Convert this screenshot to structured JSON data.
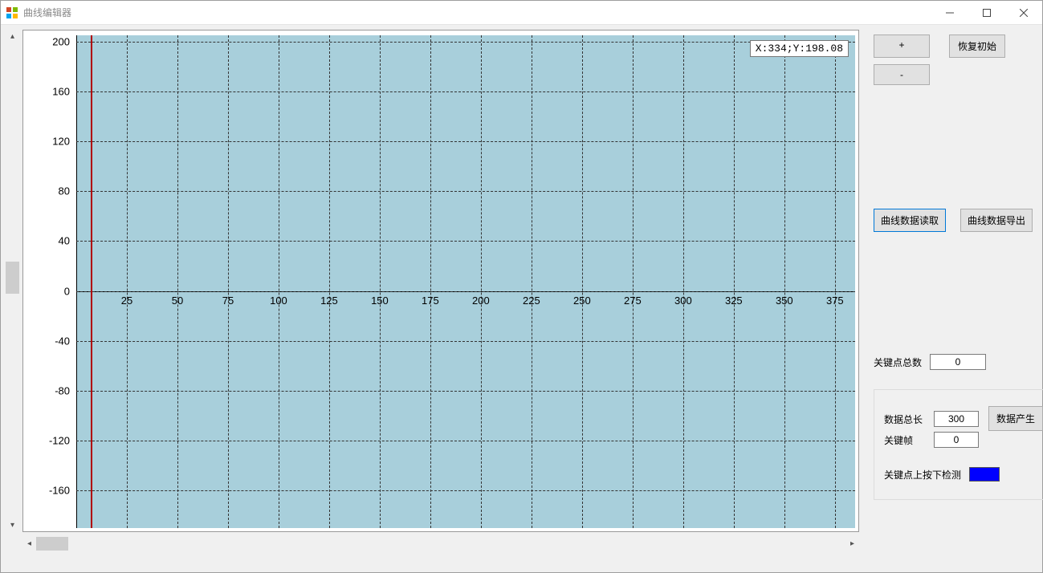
{
  "window": {
    "title": "曲线编辑器"
  },
  "chart_data": {
    "type": "line",
    "x_ticks": [
      25,
      50,
      75,
      100,
      125,
      150,
      175,
      200,
      225,
      250,
      275,
      300,
      325,
      350,
      375
    ],
    "y_ticks": [
      -160,
      -120,
      -80,
      -40,
      0,
      40,
      80,
      120,
      160,
      200
    ],
    "xlim": [
      0,
      385
    ],
    "ylim": [
      -190,
      205
    ],
    "cursor_x": 7,
    "series": [],
    "coord_readout": "X:334;Y:198.08"
  },
  "buttons": {
    "zoom_in": "+",
    "zoom_out": "-",
    "reset": "恢复初始",
    "load": "曲线数据读取",
    "export": "曲线数据导出",
    "generate": "数据产生"
  },
  "labels": {
    "key_count": "关键点总数",
    "data_length": "数据总长",
    "key_frame": "关键帧",
    "key_press_detect": "关键点上按下检测"
  },
  "values": {
    "key_count": "0",
    "data_length": "300",
    "key_frame": "0"
  },
  "colors": {
    "detect": "#0000ff"
  }
}
